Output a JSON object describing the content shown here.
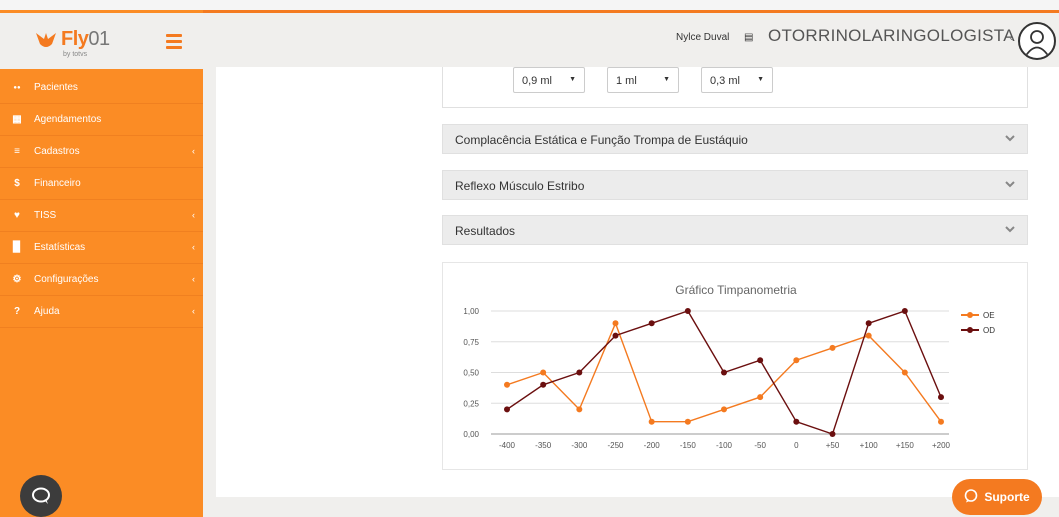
{
  "app": {
    "brand": "Fly",
    "brand_suffix": "01",
    "brand_sub": "by totvs"
  },
  "sidebar": {
    "items": [
      {
        "label": "Pacientes",
        "icon": "users-icon",
        "has_submenu": false
      },
      {
        "label": "Agendamentos",
        "icon": "calendar-icon",
        "has_submenu": false
      },
      {
        "label": "Cadastros",
        "icon": "list-icon",
        "has_submenu": true
      },
      {
        "label": "Financeiro",
        "icon": "dollar-icon",
        "has_submenu": false
      },
      {
        "label": "TISS",
        "icon": "heartbeat-icon",
        "has_submenu": true
      },
      {
        "label": "Estatísticas",
        "icon": "bar-chart-icon",
        "has_submenu": true
      },
      {
        "label": "Configurações",
        "icon": "gear-icon",
        "has_submenu": true
      },
      {
        "label": "Ajuda",
        "icon": "question-icon",
        "has_submenu": true
      }
    ]
  },
  "header": {
    "user_name": "Nylce Duval",
    "specialty": "OTORRINOLARINGOLOGISTA"
  },
  "volumes": [
    "0,9 ml",
    "1 ml",
    "0,3 ml"
  ],
  "sections": [
    {
      "title": "Complacência Estática e Função Trompa de Eustáquio"
    },
    {
      "title": "Reflexo Músculo Estribo"
    },
    {
      "title": "Resultados"
    }
  ],
  "chart_data": {
    "type": "line",
    "title": "Gráfico Timpanometria",
    "categories": [
      "-400",
      "-350",
      "-300",
      "-250",
      "-200",
      "-150",
      "-100",
      "-50",
      "0",
      "+50",
      "+100",
      "+150",
      "+200"
    ],
    "yticks": [
      "0,00",
      "0,25",
      "0,50",
      "0,75",
      "1,00"
    ],
    "ylim": [
      0,
      1
    ],
    "series": [
      {
        "name": "OE",
        "color": "#f47a20",
        "values": [
          0.4,
          0.5,
          0.2,
          0.9,
          0.1,
          0.1,
          0.2,
          0.3,
          0.6,
          0.7,
          0.8,
          0.5,
          0.1
        ]
      },
      {
        "name": "OD",
        "color": "#6b0f0f",
        "values": [
          0.2,
          0.4,
          0.5,
          0.8,
          0.9,
          1.0,
          0.5,
          0.6,
          0.1,
          0.0,
          0.9,
          1.0,
          0.3
        ]
      }
    ],
    "grid": true,
    "legend": "right"
  },
  "support": {
    "label": "Suporte"
  }
}
